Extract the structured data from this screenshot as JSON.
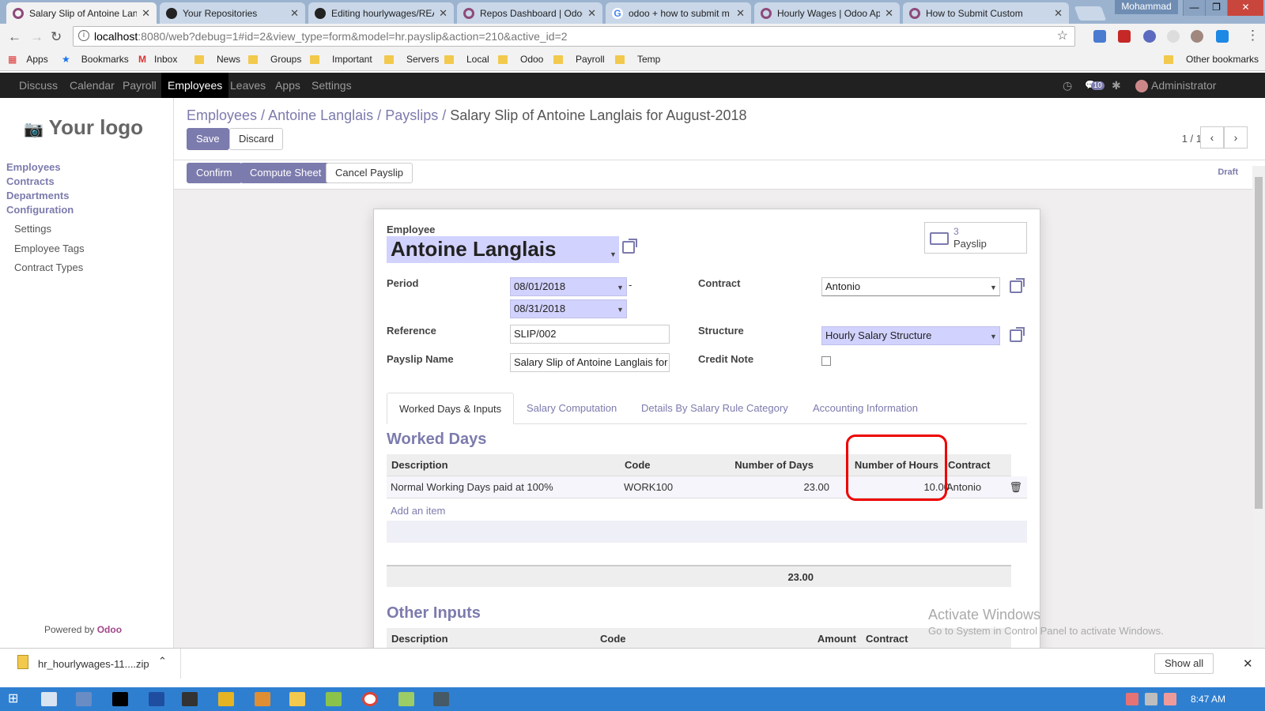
{
  "browser": {
    "tabs": [
      {
        "title": "Salary Slip of Antoine Lan",
        "active": true,
        "icon": "odoo-icon"
      },
      {
        "title": "Your Repositories",
        "icon": "github-icon"
      },
      {
        "title": "Editing hourlywages/REA",
        "icon": "github-icon"
      },
      {
        "title": "Repos Dashboard | Odoo",
        "icon": "odoo-icon"
      },
      {
        "title": "odoo + how to submit m",
        "icon": "google-icon"
      },
      {
        "title": "Hourly Wages | Odoo Ap",
        "icon": "odoo-icon"
      },
      {
        "title": "How to Submit Custom",
        "icon": "odoo-icon"
      }
    ],
    "profile": "Mohammad",
    "url_host": "localhost",
    "url_path": ":8080/web?debug=1#id=2&view_type=form&model=hr.payslip&action=210&active_id=2",
    "bookmarks": [
      "Apps",
      "Bookmarks",
      "Inbox",
      "News",
      "Groups",
      "Important",
      "Servers",
      "Local",
      "Odoo",
      "Payroll",
      "Temp"
    ],
    "other_bookmarks": "Other bookmarks"
  },
  "topnav": {
    "items": [
      "Discuss",
      "Calendar",
      "Payroll",
      "Employees",
      "Leaves",
      "Apps",
      "Settings"
    ],
    "active": "Employees",
    "chat_count": "10",
    "user": "Administrator (DEMO2)"
  },
  "sidebar": {
    "logo": "Your logo",
    "headers": [
      "Employees",
      "Contracts",
      "Departments",
      "Configuration"
    ],
    "subitems": [
      "Settings",
      "Employee Tags",
      "Contract Types"
    ],
    "powered_prefix": "Powered by",
    "powered_brand": "Odoo"
  },
  "control": {
    "breadcrumbs": [
      "Employees",
      "Antoine Langlais",
      "Payslips"
    ],
    "breadcrumb_current": "Salary Slip of Antoine Langlais for August-2018",
    "save": "Save",
    "discard": "Discard",
    "pager": "1 / 1",
    "confirm": "Confirm",
    "compute": "Compute Sheet",
    "cancel": "Cancel Payslip",
    "state": "Draft"
  },
  "form": {
    "employee_label": "Employee",
    "employee": "Antoine Langlais",
    "smart_count": "3",
    "smart_label": "Payslip",
    "period_label": "Period",
    "date_from": "08/01/2018",
    "date_to": "08/31/2018",
    "dash": "-",
    "contract_label": "Contract",
    "contract": "Antonio",
    "reference_label": "Reference",
    "reference": "SLIP/002",
    "structure_label": "Structure",
    "structure": "Hourly Salary Structure",
    "name_label": "Payslip Name",
    "name": "Salary Slip of Antoine Langlais for",
    "credit_label": "Credit Note",
    "credit_note": false
  },
  "tabs": [
    "Worked Days & Inputs",
    "Salary Computation",
    "Details By Salary Rule Category",
    "Accounting Information"
  ],
  "worked_days": {
    "title": "Worked Days",
    "columns": [
      "Description",
      "Code",
      "Number of Days",
      "Number of Hours",
      "Contract"
    ],
    "rows": [
      {
        "description": "Normal Working Days paid at 100%",
        "code": "WORK100",
        "days": "23.00",
        "hours": "10.00",
        "contract": "Antonio"
      }
    ],
    "add_item": "Add an item",
    "total_days": "23.00"
  },
  "other_inputs": {
    "title": "Other Inputs",
    "columns": [
      "Description",
      "Code",
      "Amount",
      "Contract"
    ]
  },
  "watermark": {
    "line1": "Activate Windows",
    "line2": "Go to System in Control Panel to activate Windows."
  },
  "download": {
    "file": "hr_hourlywages-11....zip",
    "show_all": "Show all"
  },
  "taskbar": {
    "time": "8:47 AM"
  }
}
